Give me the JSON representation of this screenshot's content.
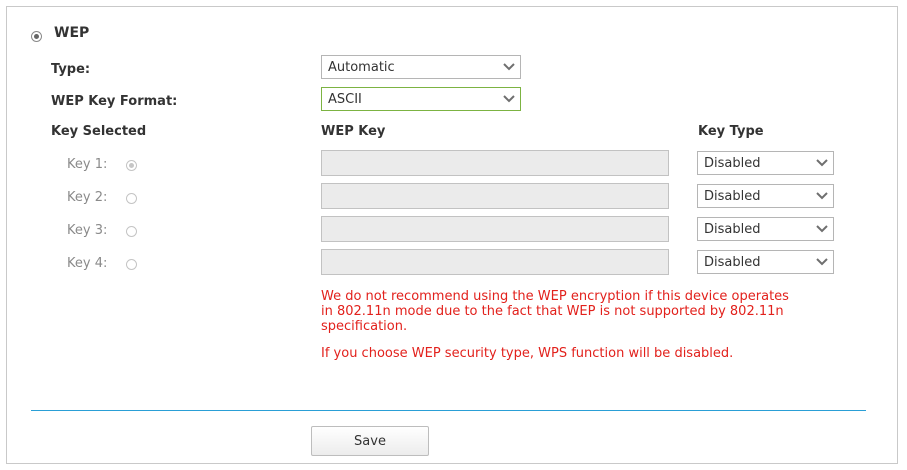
{
  "wep": {
    "title": "WEP",
    "type_label": "Type:",
    "type_value": "Automatic",
    "format_label": "WEP Key Format:",
    "format_value": "ASCII",
    "col_key_selected": "Key Selected",
    "col_wep_key": "WEP Key",
    "col_key_type": "Key Type",
    "keys": [
      {
        "label": "Key 1:",
        "selected": true,
        "value": "",
        "type": "Disabled"
      },
      {
        "label": "Key 2:",
        "selected": false,
        "value": "",
        "type": "Disabled"
      },
      {
        "label": "Key 3:",
        "selected": false,
        "value": "",
        "type": "Disabled"
      },
      {
        "label": "Key 4:",
        "selected": false,
        "value": "",
        "type": "Disabled"
      }
    ],
    "warning_1_line1": "We do not recommend using the WEP encryption if this device operates",
    "warning_1_line2": "in 802.11n mode due to the fact that WEP is not supported by 802.11n",
    "warning_1_line3": "specification.",
    "warning_2": "If you choose WEP security type, WPS function will be disabled."
  },
  "actions": {
    "save_label": "Save"
  },
  "icons": {
    "radio": "radio-icon",
    "dropdown": "chevron-down-icon"
  },
  "colors": {
    "warning": "#e2211c",
    "divider": "#2a9fd6",
    "focus_border": "#7cb342"
  }
}
